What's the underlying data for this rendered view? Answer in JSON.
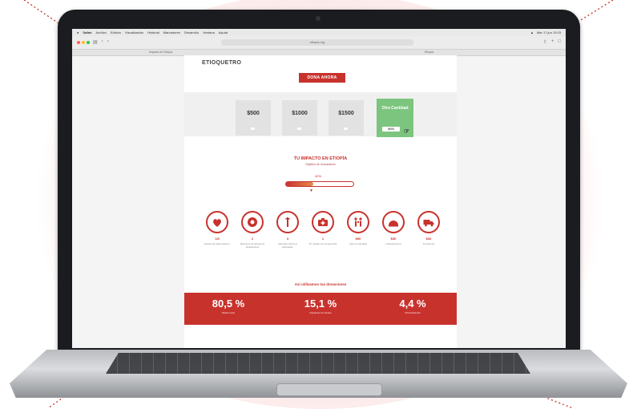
{
  "menubar": {
    "items": [
      "Safari",
      "Archivo",
      "Edición",
      "Visualización",
      "Historial",
      "Marcadores",
      "Desarrollo",
      "Ventana",
      "Ayuda"
    ],
    "clock": "Mar 17 jun 13:15"
  },
  "browser": {
    "url": "etiopia.org",
    "tab_left": "Impacto en Etiopía",
    "tab_right": "Etiopía"
  },
  "page": {
    "brand": "ETIOQUETRO",
    "donate_label": "DONA AHORA",
    "amounts": [
      "$500",
      "$1000",
      "$1500"
    ],
    "custom": {
      "title": "Otra Cantidad",
      "input": "$000"
    },
    "impact_title": "TU IMPACTO EN ETIOPÍA",
    "impact_subtitle": "Objetivo de recaudación",
    "progress": {
      "label": "40%",
      "fraction": 0.4
    },
    "impact_items": [
      {
        "count": "1/5",
        "label": "Equipo de alimentación"
      },
      {
        "count": "2",
        "label": "Raciones de alimentos terapéuticos"
      },
      {
        "count": "3",
        "label": "Vacunas contra el sarampión"
      },
      {
        "count": "1",
        "label": "Kit médico de emergencia"
      },
      {
        "count": "$50",
        "label": "Apoyo a familias"
      },
      {
        "count": "$30",
        "label": "Infraestructura"
      },
      {
        "count": "$30",
        "label": "Transporte"
      }
    ],
    "allocation_title": "Así utilizamos tus donaciones",
    "allocation": [
      {
        "pct": "80,5 %",
        "caption": "Misión local"
      },
      {
        "pct": "15,1 %",
        "caption": "Captación de fondos"
      },
      {
        "pct": "4,4 %",
        "caption": "Administración"
      }
    ]
  },
  "colors": {
    "brand_red": "#c8322d",
    "custom_green": "#7cc57e",
    "backdrop": "#fde9e9"
  }
}
